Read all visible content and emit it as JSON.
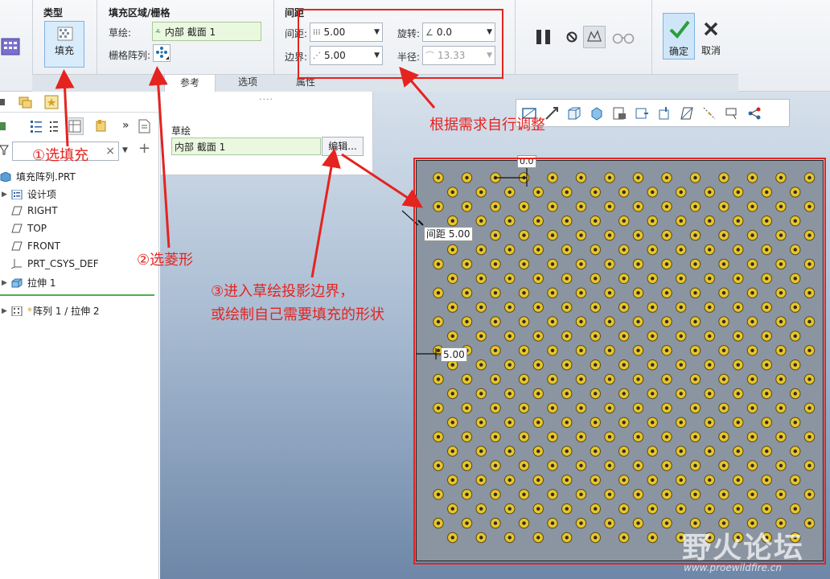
{
  "ribbon": {
    "type_group": {
      "title": "类型",
      "fill_button": "填充"
    },
    "region_group": {
      "title": "填充区域/栅格",
      "sketch_label": "草绘:",
      "sketch_value": "内部 截面 1",
      "grid_label": "栅格阵列:"
    },
    "spacing_group": {
      "title": "间距",
      "spacing_label": "间距:",
      "spacing_value": "5.00",
      "border_label": "边界:",
      "border_value": "5.00",
      "rotate_label": "旋转:",
      "rotate_value": "0.0",
      "radius_label": "半径:",
      "radius_value": "13.33"
    },
    "actions": {
      "ok": "确定",
      "cancel": "取消"
    },
    "tabs": [
      "参考",
      "选项",
      "属性"
    ]
  },
  "tree": {
    "filter_clear": "×",
    "items": [
      {
        "label": "填充阵列.PRT"
      },
      {
        "label": "设计项"
      },
      {
        "label": "RIGHT"
      },
      {
        "label": "TOP"
      },
      {
        "label": "FRONT"
      },
      {
        "label": "PRT_CSYS_DEF"
      },
      {
        "label": "拉伸 1"
      },
      {
        "label": "阵列 1 / 拉伸 2"
      }
    ]
  },
  "ref_panel": {
    "handle": "....",
    "title": "草绘",
    "value": "内部 截面 1",
    "edit_button": "编辑..."
  },
  "viewport": {
    "dim_top": "0.0",
    "dim_spacing": "间距 5.00",
    "dim_border": "5.00"
  },
  "annotations": {
    "step1": "①选填充",
    "step2": "②选菱形",
    "step3_line1": "③进入草绘投影边界，",
    "step3_line2": "或绘制自己需要填充的形状",
    "note": "根据需求自行调整"
  },
  "watermark": {
    "brand": "野火论坛",
    "url": "www.proewildfire.cn"
  },
  "colors": {
    "annotation": "#e5231f",
    "hole": "#e8c52b",
    "part": "#8a95a1"
  }
}
